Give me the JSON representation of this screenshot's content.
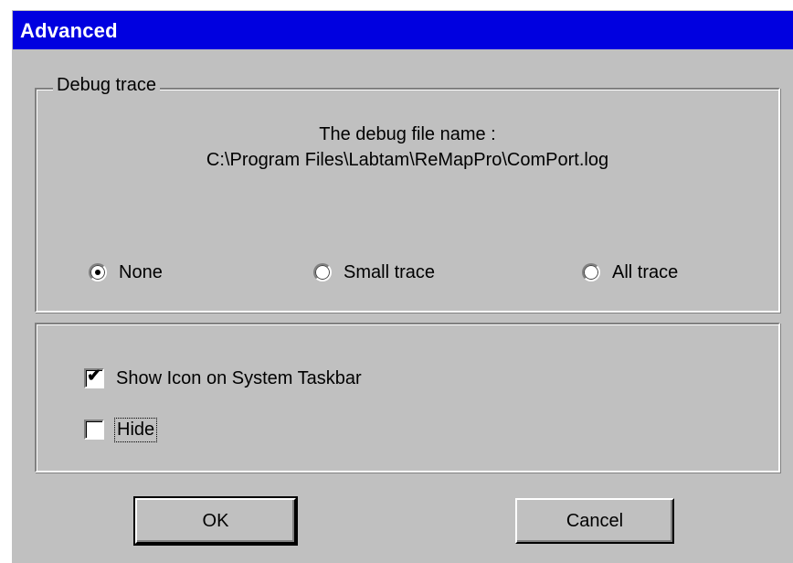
{
  "window": {
    "title": "Advanced",
    "titlebar_color": "#0000e0",
    "background_color": "#c0c0c0"
  },
  "debug_trace": {
    "group_label": "Debug trace",
    "filename_label": "The debug file name :",
    "filename_path": "C:\\Program Files\\Labtam\\ReMapPro\\ComPort.log",
    "options": [
      {
        "label": "None",
        "selected": true
      },
      {
        "label": "Small trace",
        "selected": false
      },
      {
        "label": "All trace",
        "selected": false
      }
    ]
  },
  "options": {
    "show_icon": {
      "label": "Show Icon on System Taskbar",
      "checked": true
    },
    "hide": {
      "label": "Hide",
      "checked": false,
      "focused": true
    }
  },
  "buttons": {
    "ok_label": "OK",
    "cancel_label": "Cancel"
  }
}
